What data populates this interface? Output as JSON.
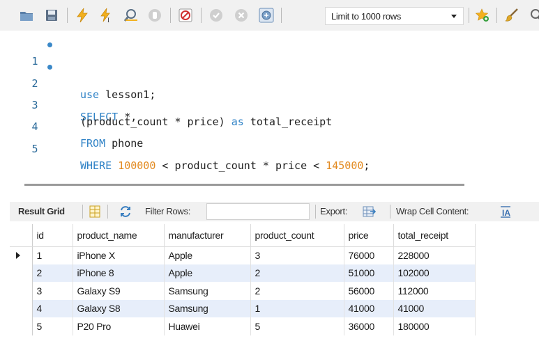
{
  "toolbar": {
    "icons": [
      "folder-icon",
      "save-icon",
      "lightning-icon",
      "lightning-cursor-icon",
      "magnifier-icon",
      "stop-icon",
      "toggle-error-icon",
      "commit-icon",
      "rollback-icon",
      "autocommit-icon",
      "star-add-icon",
      "brush-icon",
      "search-icon"
    ],
    "limit_label": "Limit to 1000 rows"
  },
  "editor": {
    "lines": [
      {
        "n": "1",
        "breakpoint": true
      },
      {
        "n": "2",
        "breakpoint": true
      },
      {
        "n": "3",
        "breakpoint": false
      },
      {
        "n": "4",
        "breakpoint": false
      },
      {
        "n": "5",
        "breakpoint": false
      }
    ],
    "tokens": {
      "l1_kw": "use",
      "l1_rest": " lesson1;",
      "l2_kw": "SELECT",
      "l2_rest": " *,",
      "l3_a": "(product_count * price) ",
      "l3_kw": "as",
      "l3_b": " total_receipt",
      "l4_kw": "FROM",
      "l4_rest": " phone",
      "l5_kw": "WHERE",
      "l5_sp": " ",
      "l5_n1": "100000",
      "l5_a": " < product_count * price < ",
      "l5_n2": "145000",
      "l5_end": ";"
    }
  },
  "result_toolbar": {
    "result_grid": "Result Grid",
    "filter_rows": "Filter Rows:",
    "filter_value": "",
    "export": "Export:",
    "wrap": "Wrap Cell Content:"
  },
  "grid": {
    "columns": [
      "id",
      "product_name",
      "manufacturer",
      "product_count",
      "price",
      "total_receipt"
    ],
    "rows": [
      [
        "1",
        "iPhone X",
        "Apple",
        "3",
        "76000",
        "228000"
      ],
      [
        "2",
        "iPhone 8",
        "Apple",
        "2",
        "51000",
        "102000"
      ],
      [
        "3",
        "Galaxy S9",
        "Samsung",
        "2",
        "56000",
        "112000"
      ],
      [
        "4",
        "Galaxy S8",
        "Samsung",
        "1",
        "41000",
        "41000"
      ],
      [
        "5",
        "P20 Pro",
        "Huawei",
        "5",
        "36000",
        "180000"
      ]
    ]
  },
  "colors": {
    "keyword": "#2f82c6",
    "number": "#e28a20",
    "alt_row": "#e7eefa"
  }
}
